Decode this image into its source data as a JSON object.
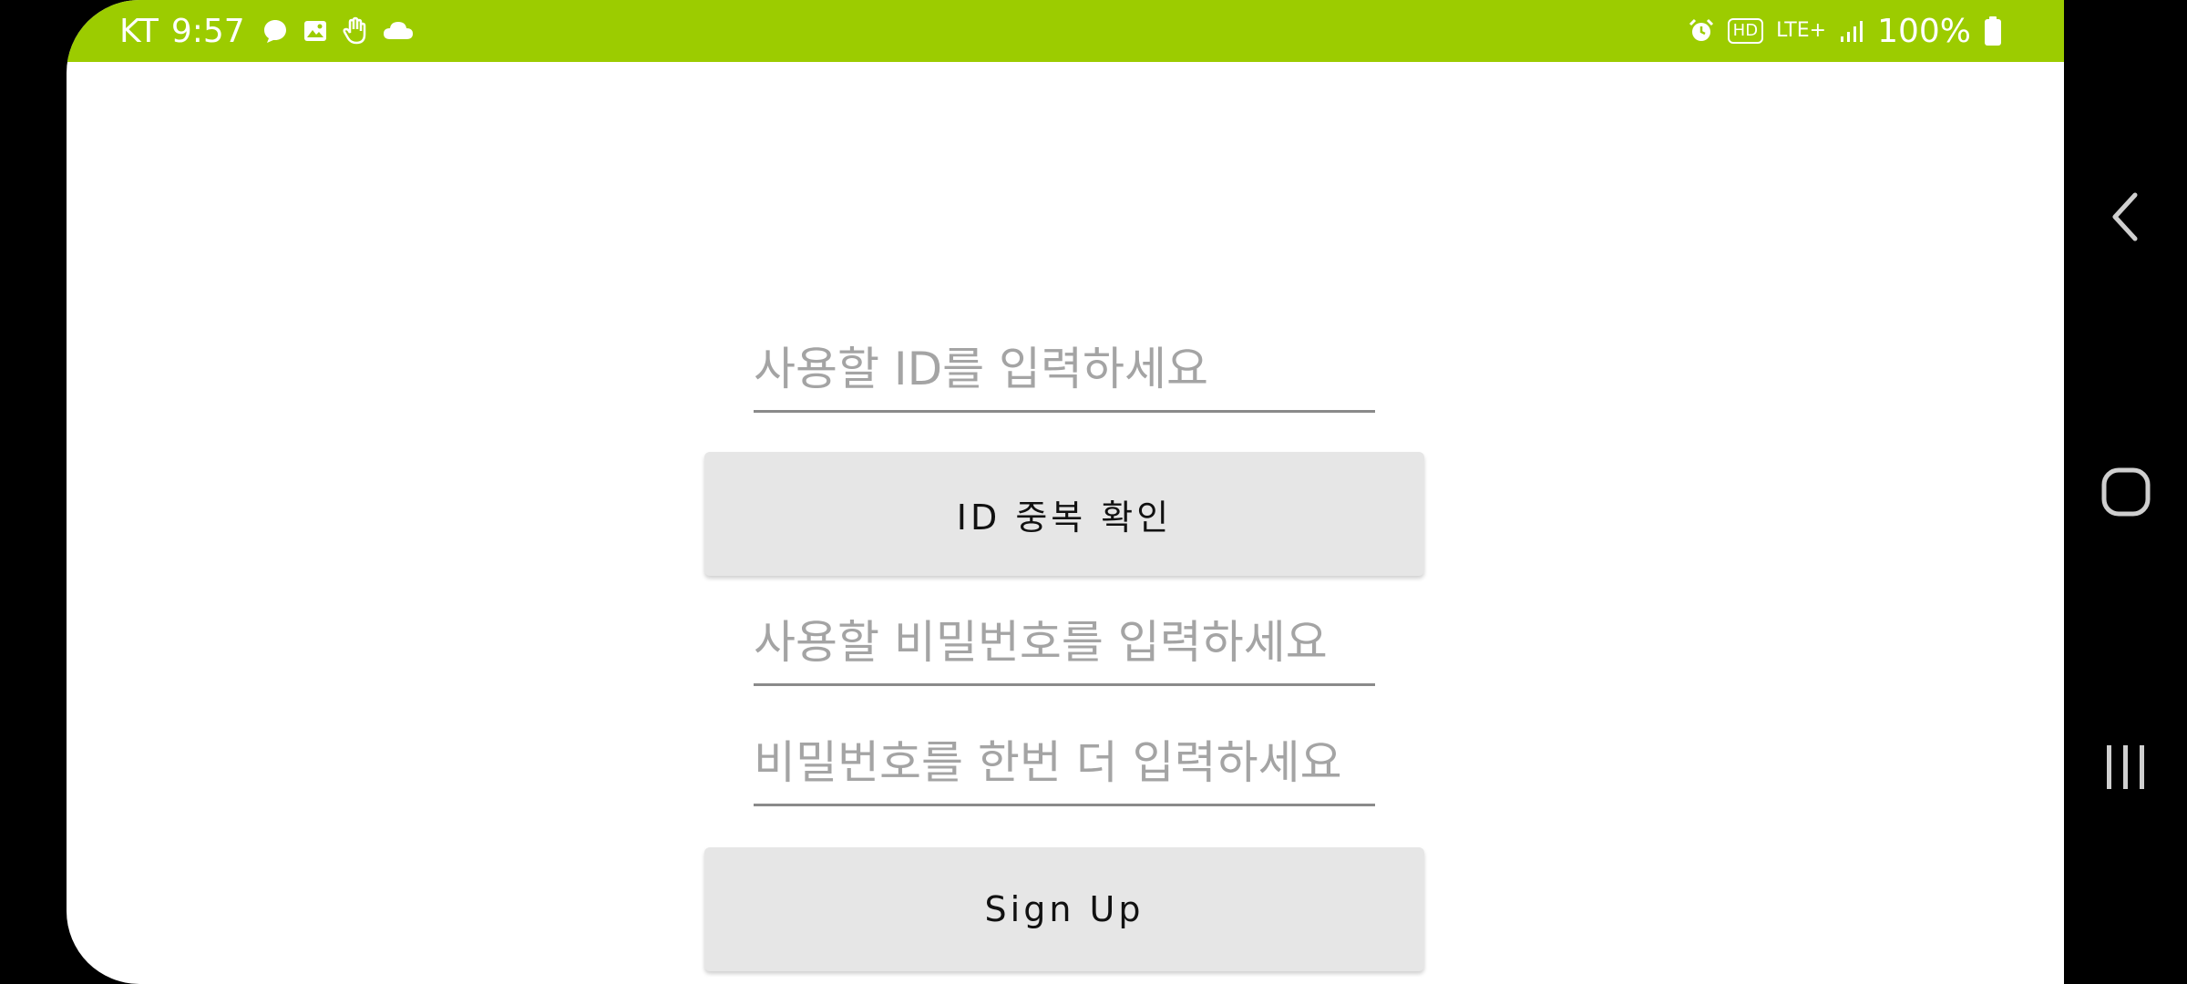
{
  "status_bar": {
    "carrier": "KT",
    "time": "9:57",
    "left_icons": [
      "chat-bubble-icon",
      "image-icon",
      "hand-icon",
      "cloud-icon"
    ],
    "right_icons": [
      "alarm-icon",
      "hd-icon",
      "lte-plus-icon",
      "signal-icon",
      "battery-icon"
    ],
    "hd_label": "HD",
    "lte_label": "LTE+",
    "battery_percent": "100%",
    "background_color": "#9ccc00"
  },
  "form": {
    "id_input": {
      "placeholder": "사용할 ID를 입력하세요",
      "value": ""
    },
    "check_id_button": {
      "label": "ID 중복 확인"
    },
    "password_input": {
      "placeholder": "사용할 비밀번호를 입력하세요",
      "value": ""
    },
    "password_confirm_input": {
      "placeholder": "비밀번호를 한번 더 입력하세요",
      "value": ""
    },
    "sign_up_button": {
      "label": "Sign Up"
    }
  },
  "navigation_bar": {
    "buttons": [
      "back-icon",
      "home-icon",
      "recent-apps-icon"
    ]
  }
}
